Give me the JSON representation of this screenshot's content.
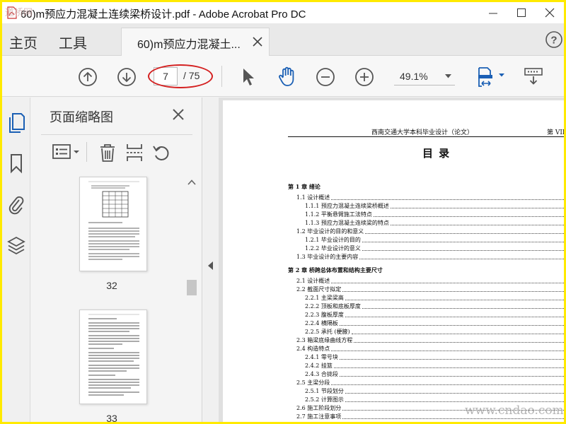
{
  "window": {
    "title": "60)m预应力混凝土连续梁桥设计.pdf - Adobe Acrobat Pro DC"
  },
  "tabs": {
    "home": "主页",
    "tools": "工具",
    "document": "60)m预应力混凝土..."
  },
  "toolbar": {
    "page_current": "7",
    "page_total": "/ 75",
    "zoom": "49.1%"
  },
  "thumbnail_panel": {
    "title": "页面缩略图",
    "pages": [
      {
        "number": "32"
      },
      {
        "number": "33"
      }
    ]
  },
  "document": {
    "header_center": "西南交通大学本科毕业设计（论文）",
    "header_right": "第 VII",
    "toc_title": "目 录",
    "toc": [
      {
        "label": "第 1 章 绪论",
        "level": 0
      },
      {
        "label": "1.1 设计概述",
        "level": 1
      },
      {
        "label": "1.1.1 预应力混凝土连续梁桥概述",
        "level": 2
      },
      {
        "label": "1.1.2 平衡悬臂施工法特点",
        "level": 2
      },
      {
        "label": "1.1.3 预应力混凝土连续梁的特点",
        "level": 2
      },
      {
        "label": "1.2 毕业设计的目的和意义",
        "level": 1
      },
      {
        "label": "1.2.1 毕业设计的目的",
        "level": 2
      },
      {
        "label": "1.2.2 毕业设计的意义",
        "level": 2
      },
      {
        "label": "1.3 毕业设计的主要内容",
        "level": 1
      },
      {
        "label": "第 2 章 桥跨总体布置和结构主要尺寸",
        "level": 0
      },
      {
        "label": "2.1 设计概述",
        "level": 1
      },
      {
        "label": "2.2 截面尺寸拟定",
        "level": 1
      },
      {
        "label": "2.2.1 主梁梁高",
        "level": 2
      },
      {
        "label": "2.2.2 顶板和底板厚度",
        "level": 2
      },
      {
        "label": "2.2.3 腹板厚度",
        "level": 2
      },
      {
        "label": "2.2.4 横隔板",
        "level": 2
      },
      {
        "label": "2.2.5 承托 (梗腋)",
        "level": 2
      },
      {
        "label": "2.3 箱梁底缘曲线方程",
        "level": 1
      },
      {
        "label": "2.4 构造特点",
        "level": 1
      },
      {
        "label": "2.4.1 零号块",
        "level": 2
      },
      {
        "label": "2.4.2 挂篮",
        "level": 2
      },
      {
        "label": "2.4.3 合拢段",
        "level": 2
      },
      {
        "label": "2.5 主梁分段",
        "level": 1
      },
      {
        "label": "2.5.1 节段划分",
        "level": 2
      },
      {
        "label": "2.5.2 计算图示",
        "level": 2
      },
      {
        "label": "2.6 施工阶段划分",
        "level": 1
      },
      {
        "label": "2.7 施工注意事项",
        "level": 1
      }
    ]
  },
  "watermarks": {
    "top": "道桥网",
    "bottom": "www.cndao.com"
  },
  "colors": {
    "annotation_red": "#d42020",
    "frame_yellow": "#ffea00",
    "acrobat_blue": "#1a5fb4"
  }
}
